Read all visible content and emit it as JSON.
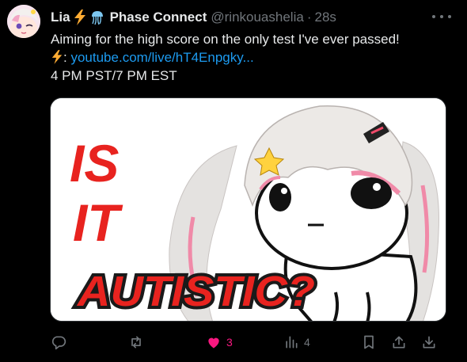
{
  "tweet": {
    "display_name": "Lia",
    "affiliate": "Phase Connect",
    "handle": "@rinkouashelia",
    "separator": "·",
    "time": "28s",
    "text_line1": "Aiming for the high score on the only test I've ever passed!",
    "link_prefix": ":",
    "link_text": "youtube.com/live/hT4Enpgky...",
    "schedule": "4 PM PST/7 PM EST"
  },
  "media": {
    "words": [
      "IS",
      "IT",
      "AUTISTIC?"
    ]
  },
  "actions": {
    "replies": "",
    "retweets": "",
    "likes": "3",
    "views": "4"
  },
  "colors": {
    "background": "#000000",
    "text": "#e7e9ea",
    "secondary": "#71767b",
    "link": "#1d9bf0",
    "like": "#f91880",
    "lightning": "#ffac33",
    "title_fill": "#e8231f"
  },
  "icons": [
    "more-icon",
    "lightning-icon",
    "jellyfish-icon",
    "reply-icon",
    "retweet-icon",
    "heart-icon",
    "views-icon",
    "bookmark-icon",
    "share-icon",
    "download-icon"
  ]
}
